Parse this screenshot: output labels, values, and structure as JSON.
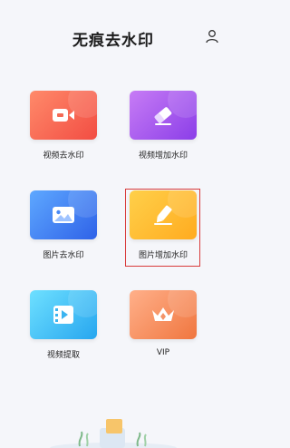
{
  "header": {
    "title": "无痕去水印",
    "user_icon": "user-icon"
  },
  "tiles": [
    {
      "label": "视频去水印",
      "icon": "video-camera-icon"
    },
    {
      "label": "视频增加水印",
      "icon": "eraser-icon"
    },
    {
      "label": "图片去水印",
      "icon": "image-icon"
    },
    {
      "label": "图片增加水印",
      "icon": "pencil-icon"
    },
    {
      "label": "视频提取",
      "icon": "film-play-icon"
    },
    {
      "label": "VIP",
      "icon": "crown-icon"
    }
  ],
  "colors": {
    "background": "#f5f6fa",
    "highlight": "#d83b3b"
  }
}
